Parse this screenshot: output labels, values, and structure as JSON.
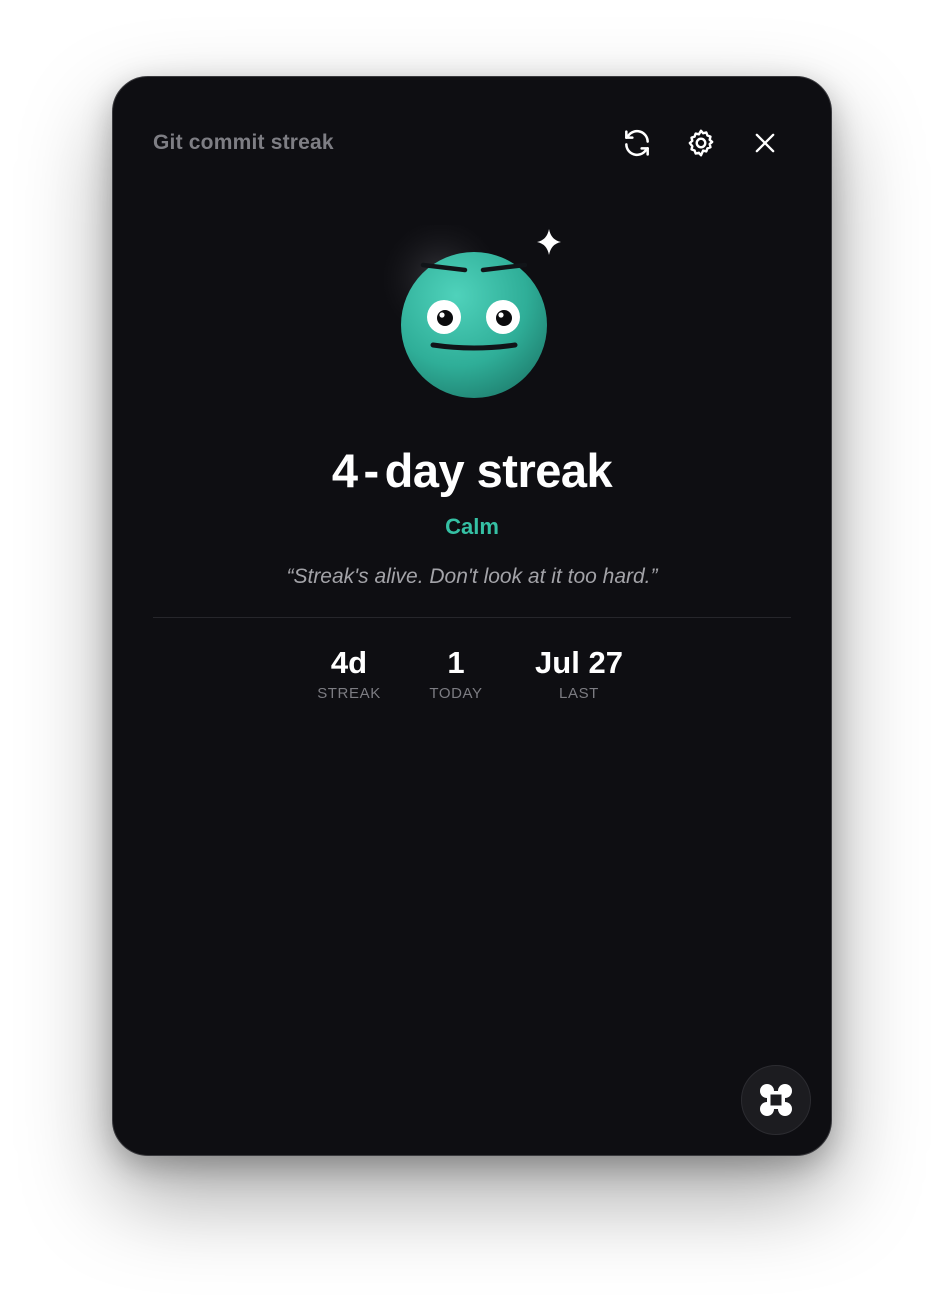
{
  "window": {
    "title": "Git commit streak"
  },
  "toolbar": {
    "refresh_icon": "refresh-icon",
    "settings_icon": "gear-icon",
    "close_icon": "close-icon"
  },
  "mascot": {
    "mood_face": "calm-face",
    "accent": "#2fae98",
    "sparkle_icon": "sparkle-icon"
  },
  "streak": {
    "count": "4",
    "separator": "-",
    "suffix": "day streak",
    "mood": "Calm",
    "mood_color": "#35c0a4",
    "quote": "“Streak's alive. Don't look at it too hard.”"
  },
  "stats": [
    {
      "value": "4d",
      "label": "STREAK"
    },
    {
      "value": "1",
      "label": "TODAY"
    },
    {
      "value": "Jul 27",
      "label": "LAST"
    }
  ],
  "fab": {
    "icon": "command-icon"
  }
}
